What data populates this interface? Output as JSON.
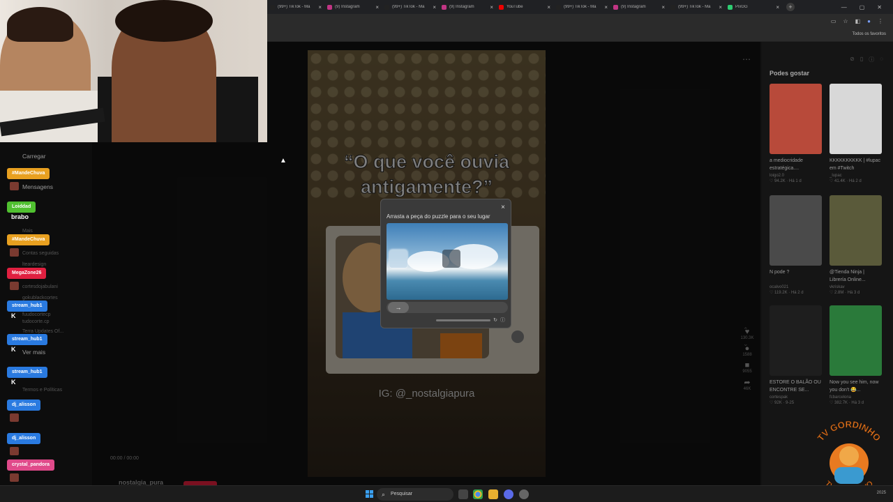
{
  "browser": {
    "tabs": [
      {
        "label": "(99+) TikTok - Ma",
        "color": "#222"
      },
      {
        "label": "(9) Instagram",
        "color": "#c13584"
      },
      {
        "label": "(99+) TikTok - Ma",
        "color": "#222"
      },
      {
        "label": "(9) Instagram",
        "color": "#c13584"
      },
      {
        "label": "YouTube",
        "color": "#e00"
      },
      {
        "label": "(99+) TikTok - Ma",
        "color": "#222"
      },
      {
        "label": "(9) Instagram",
        "color": "#c13584"
      },
      {
        "label": "(99+) TikTok - Ma",
        "color": "#222"
      },
      {
        "label": "PixGG",
        "color": "#2ecc71"
      }
    ],
    "bookmarks_all": "Todos os favoritos"
  },
  "left_nav": {
    "items": [
      "Carregar",
      "Mensagens",
      "Mais",
      "Contas seguidas",
      "Ver mais",
      "Termos e Políticas"
    ],
    "followed": [
      "lteardesign",
      "cortesdojabulani",
      "gokublackcortes",
      "fuudocortecp",
      "tudocorte.cp",
      "Terra Updates Of..."
    ]
  },
  "video": {
    "title": "“O que você ouvia antigamente?”",
    "watermark": "IG: @_nostalgiapura",
    "time": "00:00 / 00:00",
    "author": "nostalgia_pura"
  },
  "captcha": {
    "title": "Arrasta a peça do puzzle para o seu lugar",
    "close": "×",
    "slider_arrow": "→"
  },
  "actions": [
    {
      "icon": "heart-icon",
      "glyph": "♥",
      "count": "130.3K"
    },
    {
      "icon": "comment-icon",
      "glyph": "●",
      "count": "1588"
    },
    {
      "icon": "bookmark-icon",
      "glyph": "■",
      "count": "9055"
    },
    {
      "icon": "share-icon",
      "glyph": "➦",
      "count": "46K"
    }
  ],
  "sidebar": {
    "title": "Podes gostar",
    "cards": [
      {
        "title": "a mediocridade estratégica....",
        "user": "loigo2.0",
        "stats": "♡ 94.2K · Há 1 d",
        "color": "#b84a3a"
      },
      {
        "title": "KKKKKKKKKK | #lupac em #Twitch",
        "user": "_lupac",
        "stats": "♡ 41.4K · Há 2 d",
        "color": "#d8d8d8"
      },
      {
        "title": "N pode ?",
        "user": "ocalvo021",
        "stats": "♡ 119.2K · Há 2 d",
        "color": "#4a4a4a"
      },
      {
        "title": "@Tienda Ninja | Librería Online...",
        "user": "vkriskav",
        "stats": "♡ 2.8M · Há 3 d",
        "color": "#5a5a3a"
      },
      {
        "title": "ESTORE O BALÃO OU ENCONTRE SE...",
        "user": "cortespak",
        "stats": "♡ 92K · 9-25",
        "color": "#1e1e1e"
      },
      {
        "title": "Now you see him, now you don't 😂...",
        "user": "fcbarcelona",
        "stats": "♡ 382.7K · Há 3 d",
        "color": "#2a7a3a"
      }
    ]
  },
  "chat": [
    {
      "name": "#MandeChuva",
      "color": "#e8a020",
      "msg": ""
    },
    {
      "name": "Loiddad",
      "color": "#50c030",
      "msg": "brabo"
    },
    {
      "name": "#MandeChuva",
      "color": "#e8a020",
      "msg": ""
    },
    {
      "name": "MegaZone26",
      "color": "#e02040",
      "msg": ""
    },
    {
      "name": "stream_hub1",
      "color": "#2a7ae0",
      "msg": "K"
    },
    {
      "name": "stream_hub1",
      "color": "#2a7ae0",
      "msg": "K"
    },
    {
      "name": "stream_hub1",
      "color": "#2a7ae0",
      "msg": "K"
    },
    {
      "name": "dj_alisson",
      "color": "#2a7ae0",
      "msg": ""
    },
    {
      "name": "dj_alisson",
      "color": "#2a7ae0",
      "msg": ""
    },
    {
      "name": "crystal_pandora",
      "color": "#e04a8a",
      "msg": ""
    }
  ],
  "taskbar": {
    "search": "Pesquisar",
    "clock": "2025"
  },
  "watermark_logo": {
    "text_top": "TV GORDINHO",
    "text_bottom": "TV GORDINHO"
  }
}
